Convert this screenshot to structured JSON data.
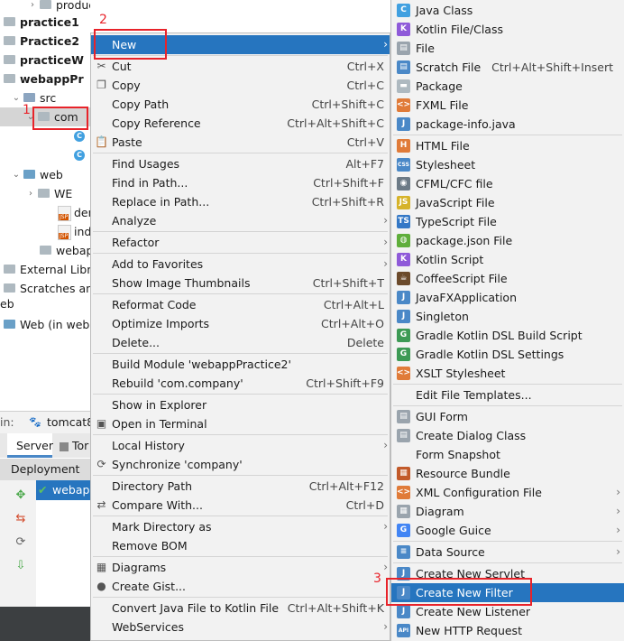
{
  "tree": {
    "items": [
      {
        "label": "production",
        "indent": 44,
        "arrow": "›",
        "icon": "folder"
      },
      {
        "label": "practice1",
        "indent": 4,
        "arrow": "›",
        "icon": "folder",
        "bold": true
      },
      {
        "label": "Practice2",
        "indent": 4,
        "arrow": "›",
        "icon": "folder",
        "bold": true
      },
      {
        "label": "practiceW",
        "indent": 4,
        "arrow": "›",
        "icon": "folder",
        "bold": true
      },
      {
        "label": "webappPr",
        "indent": 4,
        "arrow": "⌄",
        "icon": "folder",
        "bold": true
      },
      {
        "label": "src",
        "indent": 26,
        "arrow": "⌄",
        "icon": "src"
      },
      {
        "label": "com",
        "indent": 42,
        "arrow": "⌄",
        "icon": "folder",
        "selected": true
      },
      {
        "label": "",
        "indent": 82,
        "icon": "class"
      },
      {
        "label": "",
        "indent": 82,
        "icon": "class"
      },
      {
        "label": "web",
        "indent": 26,
        "arrow": "⌄",
        "icon": "web"
      },
      {
        "label": "WE",
        "indent": 42,
        "arrow": "›",
        "icon": "folder"
      },
      {
        "label": "den",
        "indent": 64,
        "icon": "jsp"
      },
      {
        "label": "ind",
        "indent": 64,
        "icon": "jsp"
      },
      {
        "label": "webap",
        "indent": 44,
        "icon": "folder"
      },
      {
        "label": "External Libra",
        "indent": 4,
        "icon": "lib"
      },
      {
        "label": "Scratches and",
        "indent": 4,
        "icon": "scratch"
      },
      {
        "label": "eb",
        "indent": 0,
        "icon": "none"
      },
      {
        "label": "Web (in weba",
        "indent": 4,
        "icon": "web"
      }
    ]
  },
  "run_bar": {
    "prefix": "in:",
    "config": "tomcat8"
  },
  "tabs": {
    "server": "Server",
    "other": "Tor"
  },
  "deployment": {
    "header": "Deployment",
    "item": "webap"
  },
  "menu": {
    "items": [
      {
        "label": "New",
        "submenu": true,
        "highlighted": true
      },
      {
        "sep": true
      },
      {
        "label": "Cut",
        "shortcut": "Ctrl+X",
        "icon": "✂"
      },
      {
        "label": "Copy",
        "shortcut": "Ctrl+C",
        "icon": "❐"
      },
      {
        "label": "Copy Path",
        "shortcut": "Ctrl+Shift+C"
      },
      {
        "label": "Copy Reference",
        "shortcut": "Ctrl+Alt+Shift+C"
      },
      {
        "label": "Paste",
        "shortcut": "Ctrl+V",
        "icon": "📋"
      },
      {
        "sep": true
      },
      {
        "label": "Find Usages",
        "shortcut": "Alt+F7"
      },
      {
        "label": "Find in Path...",
        "shortcut": "Ctrl+Shift+F"
      },
      {
        "label": "Replace in Path...",
        "shortcut": "Ctrl+Shift+R"
      },
      {
        "label": "Analyze",
        "submenu": true
      },
      {
        "sep": true
      },
      {
        "label": "Refactor",
        "submenu": true
      },
      {
        "sep": true
      },
      {
        "label": "Add to Favorites",
        "submenu": true
      },
      {
        "label": "Show Image Thumbnails",
        "shortcut": "Ctrl+Shift+T"
      },
      {
        "sep": true
      },
      {
        "label": "Reformat Code",
        "shortcut": "Ctrl+Alt+L"
      },
      {
        "label": "Optimize Imports",
        "shortcut": "Ctrl+Alt+O"
      },
      {
        "label": "Delete...",
        "shortcut": "Delete"
      },
      {
        "sep": true
      },
      {
        "label": "Build Module 'webappPractice2'"
      },
      {
        "label": "Rebuild 'com.company'",
        "shortcut": "Ctrl+Shift+F9"
      },
      {
        "sep": true
      },
      {
        "label": "Show in Explorer"
      },
      {
        "label": "Open in Terminal",
        "icon": "▣"
      },
      {
        "sep": true
      },
      {
        "label": "Local History",
        "submenu": true
      },
      {
        "label": "Synchronize 'company'",
        "icon": "⟳"
      },
      {
        "sep": true
      },
      {
        "label": "Directory Path",
        "shortcut": "Ctrl+Alt+F12"
      },
      {
        "label": "Compare With...",
        "shortcut": "Ctrl+D",
        "icon": "⇄"
      },
      {
        "sep": true
      },
      {
        "label": "Mark Directory as",
        "submenu": true
      },
      {
        "label": "Remove BOM"
      },
      {
        "sep": true
      },
      {
        "label": "Diagrams",
        "submenu": true,
        "icon": "▦"
      },
      {
        "label": "Create Gist...",
        "icon": "●"
      },
      {
        "sep": true
      },
      {
        "label": "Convert Java File to Kotlin File",
        "shortcut": "Ctrl+Alt+Shift+K"
      },
      {
        "label": "WebServices",
        "submenu": true
      }
    ]
  },
  "submenu": {
    "items": [
      {
        "label": "Java Class",
        "icon": "C",
        "color": "#41a0e0"
      },
      {
        "label": "Kotlin File/Class",
        "icon": "K",
        "color": "#8f5ad9"
      },
      {
        "label": "File",
        "icon": "▤",
        "color": "#9aa4ad"
      },
      {
        "label": "Scratch File",
        "shortcut": "Ctrl+Alt+Shift+Insert",
        "icon": "▤",
        "color": "#4a88c7"
      },
      {
        "label": "Package",
        "icon": "▬",
        "color": "#aeb9c0"
      },
      {
        "label": "FXML File",
        "icon": "<>",
        "color": "#e07b39"
      },
      {
        "label": "package-info.java",
        "icon": "J",
        "color": "#4a88c7"
      },
      {
        "sep": true
      },
      {
        "label": "HTML File",
        "icon": "H",
        "color": "#e07b39"
      },
      {
        "label": "Stylesheet",
        "icon": "CSS",
        "color": "#4a88c7"
      },
      {
        "label": "CFML/CFC file",
        "icon": "◉",
        "color": "#6c7a86"
      },
      {
        "label": "JavaScript File",
        "icon": "JS",
        "color": "#d6b32a"
      },
      {
        "label": "TypeScript File",
        "icon": "TS",
        "color": "#3478c6"
      },
      {
        "label": "package.json File",
        "icon": "◍",
        "color": "#5fae3b"
      },
      {
        "label": "Kotlin Script",
        "icon": "K",
        "color": "#8f5ad9"
      },
      {
        "label": "CoffeeScript File",
        "icon": "☕",
        "color": "#6b4a2b"
      },
      {
        "label": "JavaFXApplication",
        "icon": "J",
        "color": "#4a88c7"
      },
      {
        "label": "Singleton",
        "icon": "J",
        "color": "#4a88c7"
      },
      {
        "label": "Gradle Kotlin DSL Build Script",
        "icon": "G",
        "color": "#3d9a55"
      },
      {
        "label": "Gradle Kotlin DSL Settings",
        "icon": "G",
        "color": "#3d9a55"
      },
      {
        "label": "XSLT Stylesheet",
        "icon": "<>",
        "color": "#e07b39"
      },
      {
        "sep": true
      },
      {
        "label": "Edit File Templates..."
      },
      {
        "sep": true
      },
      {
        "label": "GUI Form",
        "icon": "▤",
        "color": "#9aa4ad"
      },
      {
        "label": "Create Dialog Class",
        "icon": "▤",
        "color": "#9aa4ad"
      },
      {
        "label": "Form Snapshot"
      },
      {
        "label": "Resource Bundle",
        "icon": "▦",
        "color": "#c25a2a"
      },
      {
        "label": "XML Configuration File",
        "submenu": true,
        "icon": "<>",
        "color": "#e07b39"
      },
      {
        "label": "Diagram",
        "submenu": true,
        "icon": "▦",
        "color": "#9aa4ad"
      },
      {
        "label": "Google Guice",
        "submenu": true,
        "icon": "G",
        "color": "#4285f4"
      },
      {
        "sep": true
      },
      {
        "label": "Data Source",
        "submenu": true,
        "icon": "≡",
        "color": "#4a88c7"
      },
      {
        "sep": true
      },
      {
        "label": "Create New Servlet",
        "icon": "J",
        "color": "#4a88c7"
      },
      {
        "label": "Create New Filter",
        "icon": "J",
        "color": "#4a88c7",
        "highlighted": true
      },
      {
        "label": "Create New Listener",
        "icon": "J",
        "color": "#4a88c7"
      },
      {
        "label": "New HTTP Request",
        "icon": "API",
        "color": "#4a88c7"
      }
    ]
  },
  "annotations": {
    "n1": "1",
    "n2": "2",
    "n3": "3",
    "accent": "#e8232a"
  }
}
